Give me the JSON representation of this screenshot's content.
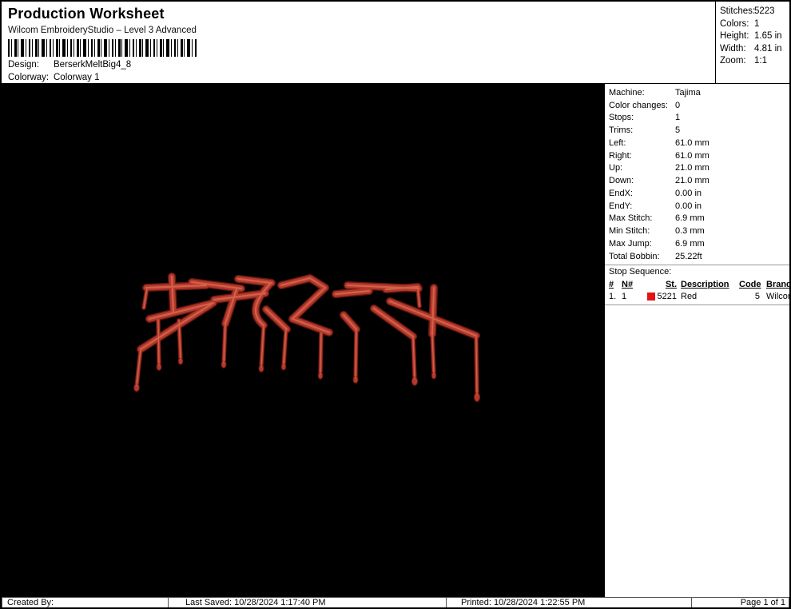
{
  "header": {
    "title": "Production Worksheet",
    "subtitle": "Wilcom EmbroideryStudio – Level 3 Advanced",
    "design_label": "Design:",
    "design_value": "BerserkMeltBig4_8",
    "colorway_label": "Colorway:",
    "colorway_value": "Colorway 1"
  },
  "summary": {
    "rows": [
      {
        "label": "Stitches:",
        "value": "5223"
      },
      {
        "label": "Colors:",
        "value": "1"
      },
      {
        "label": "Height:",
        "value": "1.65 in"
      },
      {
        "label": "Width:",
        "value": "4.81 in"
      },
      {
        "label": "Zoom:",
        "value": "1:1"
      }
    ]
  },
  "machine_info": {
    "rows": [
      {
        "label": "Machine:",
        "value": "Tajima"
      },
      {
        "label": "Color changes:",
        "value": "0"
      },
      {
        "label": "Stops:",
        "value": "1"
      },
      {
        "label": "Trims:",
        "value": "5"
      },
      {
        "label": "Left:",
        "value": "61.0 mm"
      },
      {
        "label": "Right:",
        "value": "61.0 mm"
      },
      {
        "label": "Up:",
        "value": "21.0 mm"
      },
      {
        "label": "Down:",
        "value": "21.0 mm"
      },
      {
        "label": "EndX:",
        "value": "0.00 in"
      },
      {
        "label": "EndY:",
        "value": "0.00 in"
      },
      {
        "label": "Max Stitch:",
        "value": "6.9 mm"
      },
      {
        "label": "Min Stitch:",
        "value": "0.3 mm"
      },
      {
        "label": "Max Jump:",
        "value": "6.9 mm"
      },
      {
        "label": "Total Bobbin:",
        "value": "25.22ft"
      }
    ]
  },
  "stop_sequence": {
    "title": "Stop Sequence:",
    "columns": [
      "#",
      "N#",
      "St.",
      "Description",
      "Code",
      "Brand"
    ],
    "rows": [
      {
        "num": "1.",
        "needle": "1",
        "stitches": "5221",
        "description": "Red",
        "code": "5",
        "brand": "Wilcom",
        "swatch_color": "#e21414"
      }
    ]
  },
  "canvas": {
    "depicts": "Melting 'Berserk' lettering stitched in red on black background",
    "background": "#000000",
    "thread_color": "#b23a2c",
    "thread_dark": "#6b1812",
    "thread_highlight": "#d9674f"
  },
  "footer": {
    "created_by": "Created By:",
    "last_saved": "Last Saved: 10/28/2024 1:17:40 PM",
    "printed": "Printed: 10/28/2024 1:22:55 PM",
    "page": "Page 1 of 1"
  }
}
